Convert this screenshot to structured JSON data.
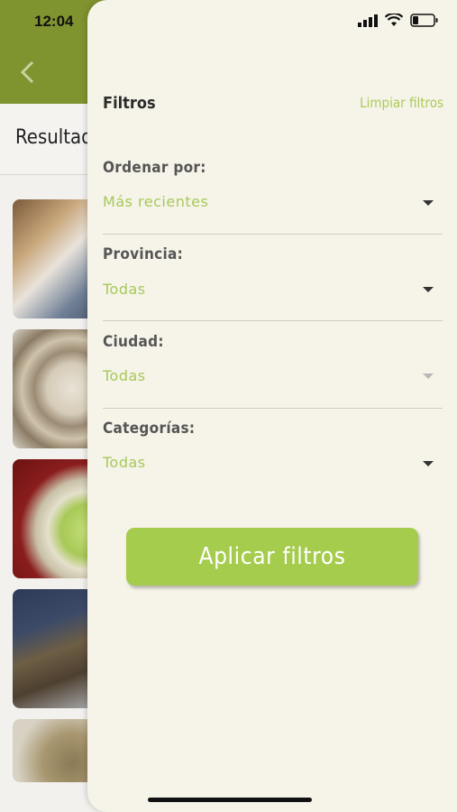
{
  "status_bar": {
    "time": "12:04"
  },
  "background": {
    "title": "Resultad"
  },
  "filters": {
    "title": "Filtros",
    "clear_label": "Limpiar filtros",
    "fields": [
      {
        "label": "Ordenar por:",
        "value": "Más recientes"
      },
      {
        "label": "Provincia:",
        "value": "Todas"
      },
      {
        "label": "Ciudad:",
        "value": "Todas"
      },
      {
        "label": "Categorías:",
        "value": "Todas"
      }
    ],
    "apply_label": "Aplicar filtros"
  },
  "colors": {
    "header": "#7f932f",
    "accent": "#a5cc4c",
    "panel": "#f6f3e8"
  }
}
